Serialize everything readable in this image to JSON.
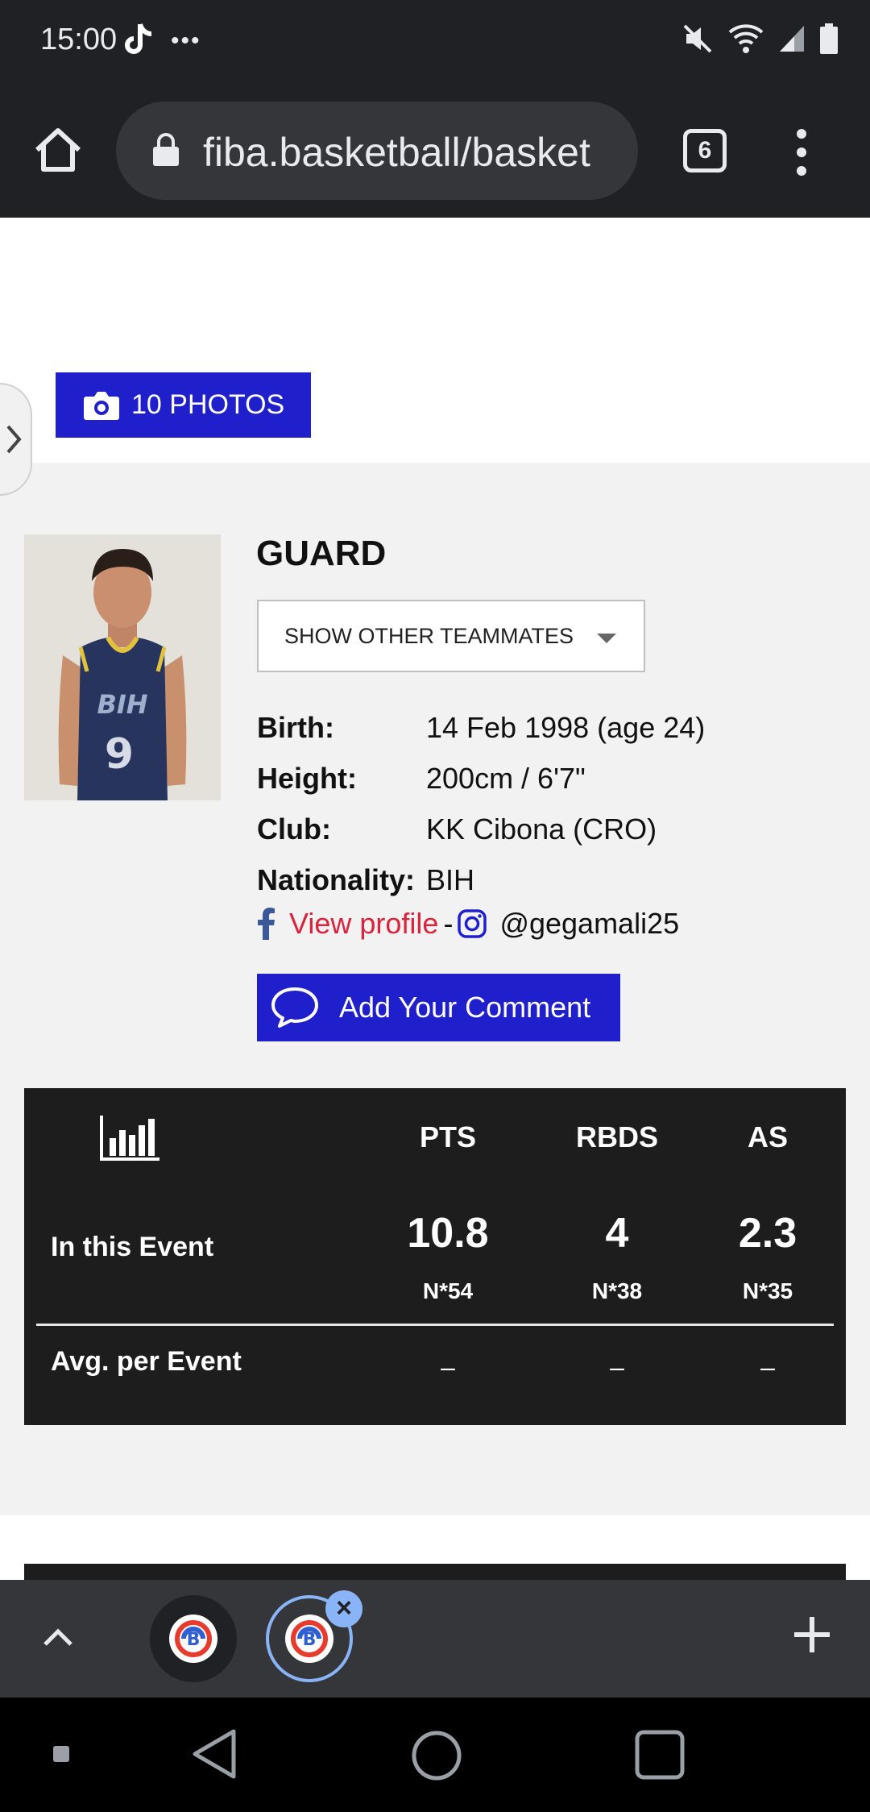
{
  "status_bar": {
    "time": "15:00",
    "dots": "•••",
    "icons": [
      "tiktok-icon",
      "mute-icon",
      "wifi-icon",
      "signal-icon",
      "battery-icon"
    ]
  },
  "browser": {
    "url": "fiba.basketball/basket",
    "tab_count": "6"
  },
  "gallery": {
    "photos_label": "10 PHOTOS"
  },
  "player": {
    "position": "GUARD",
    "teammates_select": "SHOW OTHER TEAMMATES",
    "info": [
      {
        "label": "Birth:",
        "value": "14 Feb 1998 (age 24)"
      },
      {
        "label": "Height:",
        "value": "200cm / 6'7\""
      },
      {
        "label": "Club:",
        "value": "KK Cibona (CRO)"
      },
      {
        "label": "Nationality:",
        "value": "BIH"
      }
    ],
    "social": {
      "facebook_link": "View profile",
      "separator": "-",
      "instagram_handle": "@gegamali25"
    },
    "comment_button": "Add Your Comment"
  },
  "stats": {
    "columns": [
      "PTS",
      "RBDS",
      "AS"
    ],
    "rows": [
      {
        "label": "In this Event",
        "values": [
          "10.8",
          "4",
          "2.3"
        ],
        "ranks": [
          "N*54",
          "N*38",
          "N*35"
        ]
      },
      {
        "label": "Avg. per Event",
        "values": [
          "–",
          "–",
          "–"
        ]
      }
    ]
  },
  "colors": {
    "accent": "#1f1fcc",
    "link": "#d8243c",
    "stats_bg": "#1d1d1d",
    "section_bg": "#f2f2f3",
    "chrome_dark": "#202124",
    "tab_active": "#8ab4f8"
  }
}
